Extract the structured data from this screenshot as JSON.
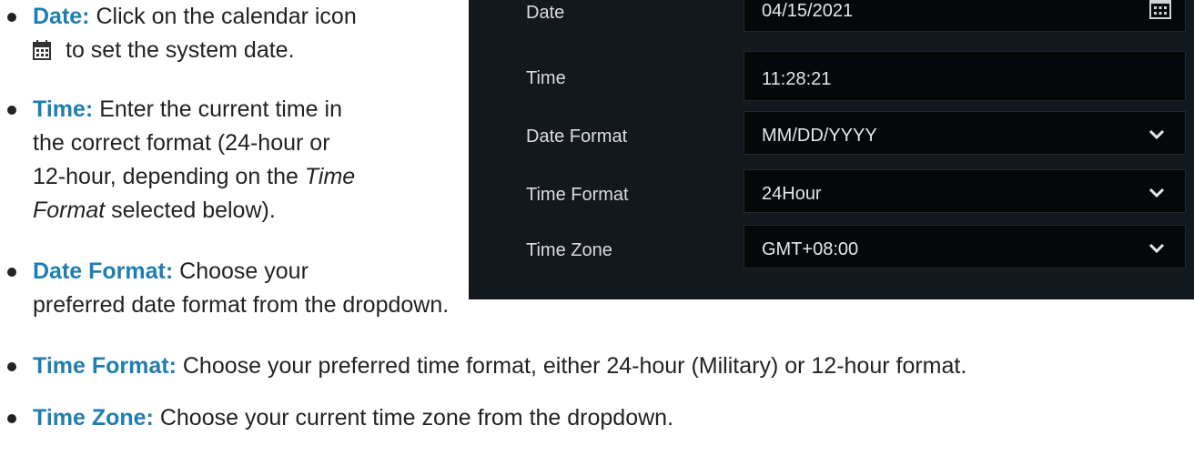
{
  "instructions": [
    {
      "term": "Date:",
      "line1": "Click on the calendar icon",
      "line2": "to set the system date."
    },
    {
      "term": "Time:",
      "line1": "Enter the current time in",
      "line2": "the correct format (24-hour or",
      "line3_pre": "12-hour, depending on the ",
      "line3_em": "Time",
      "line4_em": "Format",
      "line4_post": " selected below)."
    },
    {
      "term": "Date Format:",
      "line1": "Choose your",
      "line2": "preferred date format from the dropdown."
    },
    {
      "term": "Time Format:",
      "line1": "Choose your preferred time format, either 24-hour (Military) or 12-hour format."
    },
    {
      "term": "Time Zone:",
      "line1": "Choose your current time zone from the dropdown."
    }
  ],
  "settings": {
    "date": {
      "label": "Date",
      "value": "04/15/2021"
    },
    "time": {
      "label": "Time",
      "value": "11:28:21"
    },
    "date_format": {
      "label": "Date Format",
      "value": "MM/DD/YYYY"
    },
    "time_format": {
      "label": "Time Format",
      "value": "24Hour"
    },
    "time_zone": {
      "label": "Time Zone",
      "value": "GMT+08:00"
    }
  },
  "colors": {
    "accent": "#1f7eb1",
    "panel_bg": "#13181d",
    "field_bg": "#050708"
  }
}
